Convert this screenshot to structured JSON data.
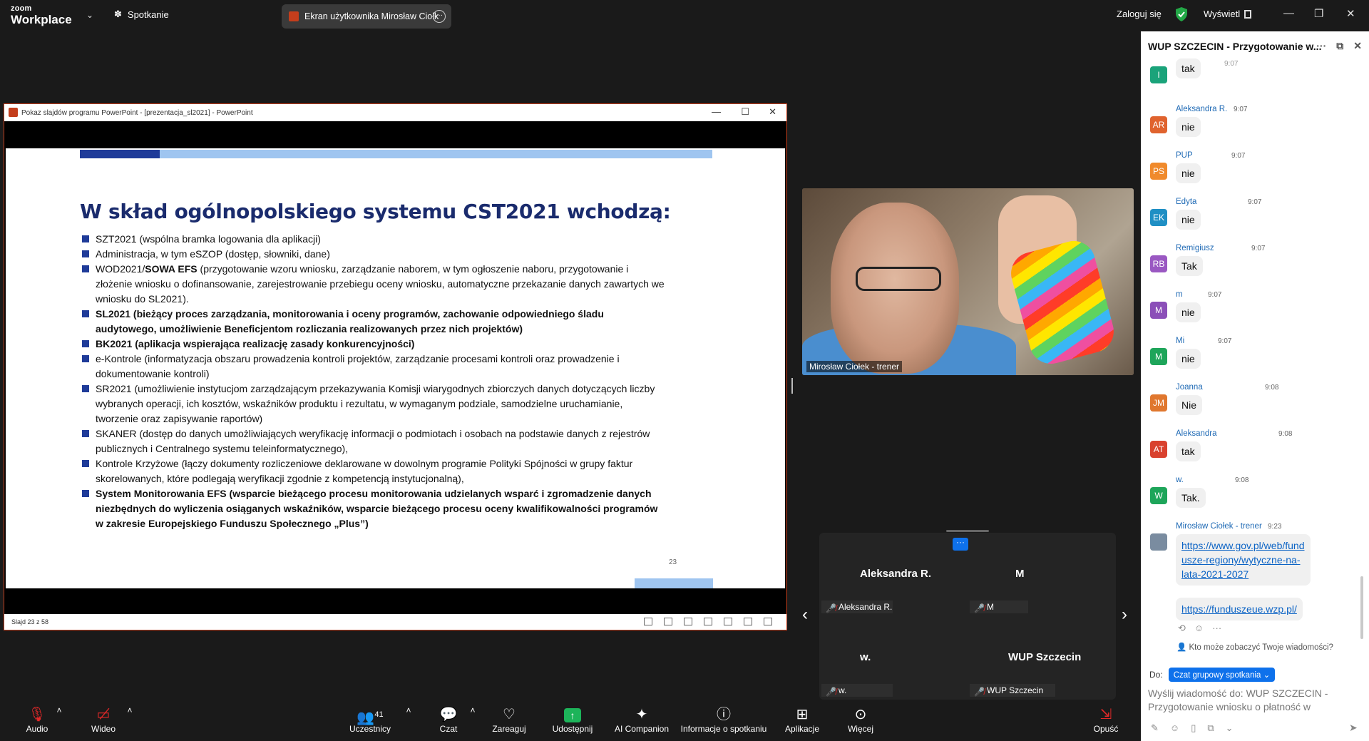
{
  "topbar": {
    "logo_line1": "zoom",
    "logo_line2": "Workplace",
    "meeting_label": "Spotkanie",
    "share_tab": "Ekran użytkownika Mirosław Ciołk",
    "login": "Zaloguj się",
    "view": "Wyświetl"
  },
  "ppt": {
    "title": "Pokaz slajdów programu PowerPoint - [prezentacja_sl2021] - PowerPoint",
    "status": "Slajd 23 z 58",
    "slide_title": "W skład ogólnopolskiego systemu CST2021 wchodzą:",
    "page_number": "23",
    "bullets": [
      {
        "text": "SZT2021 (wspólna bramka logowania dla aplikacji)"
      },
      {
        "text": "Administracja, w tym eSZOP (dostęp, słowniki, dane)"
      },
      {
        "text_a": "WOD2021/",
        "text_b": "SOWA EFS",
        "text_c": " (przygotowanie wzoru wniosku, zarządzanie naborem, w tym ogłoszenie naboru, przygotowanie i złożenie wniosku o dofinansowanie, zarejestrowanie przebiegu oceny wniosku, automatyczne przekazanie danych zawartych we wniosku do SL2021)."
      },
      {
        "text": "SL2021 (bieżący proces zarządzania, monitorowania i oceny programów, zachowanie odpowiedniego śladu audytowego, umożliwienie Beneficjentom rozliczania realizowanych przez nich projektów)"
      },
      {
        "text": "BK2021 (aplikacja wspierająca realizację zasady konkurencyjności)"
      },
      {
        "text": "e-Kontrole (informatyzacja obszaru prowadzenia kontroli projektów, zarządzanie procesami kontroli oraz prowadzenie i dokumentowanie kontroli)"
      },
      {
        "text": "SR2021 (umożliwienie instytucjom zarządzającym przekazywania Komisji wiarygodnych zbiorczych danych dotyczących liczby wybranych operacji, ich kosztów, wskaźników produktu i rezultatu, w wymaganym podziale, samodzielne uruchamianie, tworzenie oraz zapisywanie raportów)"
      },
      {
        "text": "SKANER (dostęp do danych umożliwiających weryfikację informacji o podmiotach i osobach na podstawie danych z rejestrów publicznych i Centralnego systemu teleinformatycznego),"
      },
      {
        "text": "Kontrole Krzyżowe (łączy dokumenty rozliczeniowe deklarowane w dowolnym programie Polityki Spójności w grupy faktur skorelowanych, które podlegają weryfikacji zgodnie z kompetencją instytucjonalną),"
      },
      {
        "text": "System Monitorowania EFS (wsparcie bieżącego procesu monitorowania udzielanych wsparć i zgromadzenie danych niezbędnych do wyliczenia osiąganych wskaźników, wsparcie bieżącego procesu oceny kwalifikowalności programów  w zakresie Europejskiego Funduszu Społecznego „Plus”)"
      }
    ]
  },
  "video": {
    "label": "Mirosław Ciołek - trener"
  },
  "gallery": {
    "tiles": [
      {
        "name": "Aleksandra R.",
        "tag": "Aleksandra R."
      },
      {
        "name": "M",
        "tag": "M"
      },
      {
        "name": "w.",
        "tag": "w."
      },
      {
        "name": "WUP Szczecin",
        "tag": "WUP Szczecin"
      }
    ]
  },
  "chat": {
    "title": "WUP SZCZECIN - Przygotowanie w...",
    "cutoff_time": "9:07",
    "messages": [
      {
        "initials": "I",
        "color": "#1aa37a",
        "sender": "",
        "time": "",
        "text": "tak"
      },
      {
        "initials": "AR",
        "color": "#e0632e",
        "sender": "Aleksandra R.",
        "time": "9:07",
        "text": "nie"
      },
      {
        "initials": "PS",
        "color": "#f08a2c",
        "sender": "PUP",
        "time": "9:07",
        "text": "nie"
      },
      {
        "initials": "EK",
        "color": "#1f8fc4",
        "sender": "Edyta",
        "time": "9:07",
        "text": "nie"
      },
      {
        "initials": "RB",
        "color": "#9a58c2",
        "sender": "Remigiusz",
        "time": "9:07",
        "text": "Tak"
      },
      {
        "initials": "M",
        "color": "#8b4fb8",
        "sender": "m",
        "time": "9:07",
        "text": "nie"
      },
      {
        "initials": "M",
        "color": "#1ea55a",
        "sender": "Mi",
        "time": "9:07",
        "text": "nie"
      },
      {
        "initials": "JM",
        "color": "#e0772e",
        "sender": "Joanna",
        "time": "9:08",
        "text": "Nie"
      },
      {
        "initials": "AT",
        "color": "#d9412e",
        "sender": "Aleksandra",
        "time": "9:08",
        "text": "tak"
      },
      {
        "initials": "W",
        "color": "#1ea55a",
        "sender": "w.",
        "time": "9:08",
        "text": "Tak."
      }
    ],
    "trainer_sender": "Mirosław Ciołek - trener",
    "trainer_time": "9:23",
    "link1": "https://www.gov.pl/web/fundusze-regiony/wytyczne-na-lata-2021-2027",
    "link1_l1": "https://www.gov.pl/web/fund",
    "link1_l2": "usze-regiony/wytyczne-na-",
    "link1_l3": "lata-2021-2027",
    "link2": "https://funduszeue.wzp.pl/",
    "visibility": "Kto może zobaczyć Twoje wiadomości?",
    "to_label": "Do:",
    "to_value": "Czat grupowy spotkania",
    "compose_placeholder": "Wyślij wiadomość do: WUP SZCZECIN - Przygotowanie wniosku o płatność w"
  },
  "toolbar": {
    "audio": "Audio",
    "video": "Wideo",
    "participants": "Uczestnicy",
    "participants_count": "41",
    "chat": "Czat",
    "react": "Zareaguj",
    "share": "Udostępnij",
    "ai": "AI Companion",
    "info": "Informacje o spotkaniu",
    "apps": "Aplikacje",
    "more": "Więcej",
    "leave": "Opuść"
  }
}
